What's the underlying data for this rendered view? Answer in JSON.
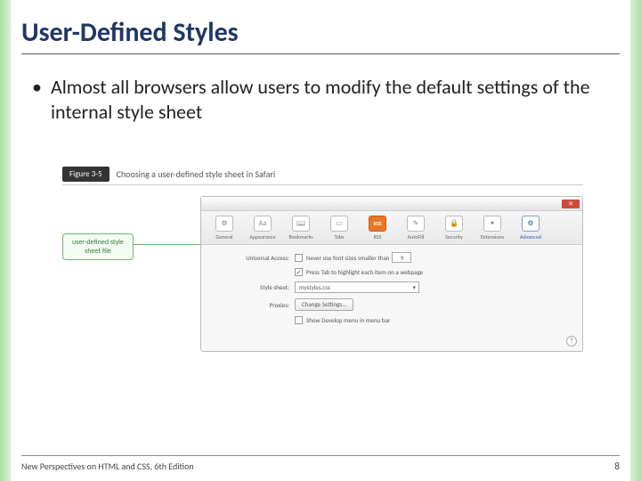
{
  "title": "User-Defined Styles",
  "bullet": "Almost all browsers allow users to modify the default settings of the internal style sheet",
  "figure": {
    "tag": "Figure 3-5",
    "caption": "Choosing a user-defined style sheet in Safari",
    "callout": "user-defined style sheet file"
  },
  "safari": {
    "close": "✕",
    "tabs": {
      "general": "General",
      "appearance": "Appearance",
      "bookmarks": "Bookmarks",
      "tabs": "Tabs",
      "rss": "RSS",
      "autofill": "AutoFill",
      "security": "Security",
      "extensions": "Extensions",
      "advanced": "Advanced"
    },
    "rows": {
      "universal_label": "Universal Access:",
      "font_checkbox": "Never use font sizes smaller than",
      "font_value": "9",
      "press_tab": "Press Tab to highlight each item on a webpage",
      "checkmark": "✓",
      "stylesheet_label": "Style sheet:",
      "stylesheet_value": "mystyles.css",
      "proxies_label": "Proxies:",
      "proxies_button": "Change Settings...",
      "show_develop": "Show Develop menu in menu bar"
    },
    "help": "?"
  },
  "footer": {
    "left": "New Perspectives on HTML and CSS, 6th Edition",
    "page": "8"
  }
}
